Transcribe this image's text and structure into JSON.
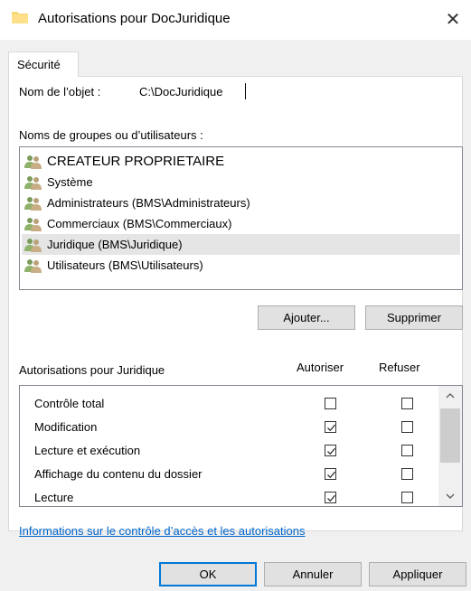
{
  "window": {
    "title": "Autorisations pour DocJuridique",
    "close_symbol": "✕"
  },
  "tabs": [
    {
      "label": "Sécurité"
    }
  ],
  "object": {
    "label": "Nom de l’objet :",
    "value": "C:\\DocJuridique"
  },
  "groups": {
    "label": "Noms de groupes ou d’utilisateurs :",
    "selected": "Juridique (BMS\\Juridique)",
    "items": [
      {
        "label": "CREATEUR PROPRIETAIRE",
        "icon": "users-icon"
      },
      {
        "label": "Système",
        "icon": "users-icon"
      },
      {
        "label": "Administrateurs (BMS\\Administrateurs)",
        "icon": "users-icon"
      },
      {
        "label": "Commerciaux (BMS\\Commerciaux)",
        "icon": "users-icon"
      },
      {
        "label": "Juridique (BMS\\Juridique)",
        "icon": "users-icon"
      },
      {
        "label": "Utilisateurs (BMS\\Utilisateurs)",
        "icon": "users-icon"
      }
    ]
  },
  "group_buttons": {
    "add": "Ajouter...",
    "remove": "Supprimer"
  },
  "permissions": {
    "title": "Autorisations pour Juridique",
    "col_allow": "Autoriser",
    "col_deny": "Refuser",
    "rows": [
      {
        "label": "Contrôle total",
        "allow": false,
        "deny": false
      },
      {
        "label": "Modification",
        "allow": true,
        "deny": false
      },
      {
        "label": "Lecture et exécution",
        "allow": true,
        "deny": false
      },
      {
        "label": "Affichage du contenu du dossier",
        "allow": true,
        "deny": false
      },
      {
        "label": "Lecture",
        "allow": true,
        "deny": false
      }
    ]
  },
  "link": "Informations sur le contrôle d’accès et les autorisations",
  "footer": {
    "ok": "OK",
    "cancel": "Annuler",
    "apply": "Appliquer"
  },
  "colors": {
    "accent": "#0078d7",
    "link": "#0066cc",
    "selection": "#e5e5e5"
  }
}
